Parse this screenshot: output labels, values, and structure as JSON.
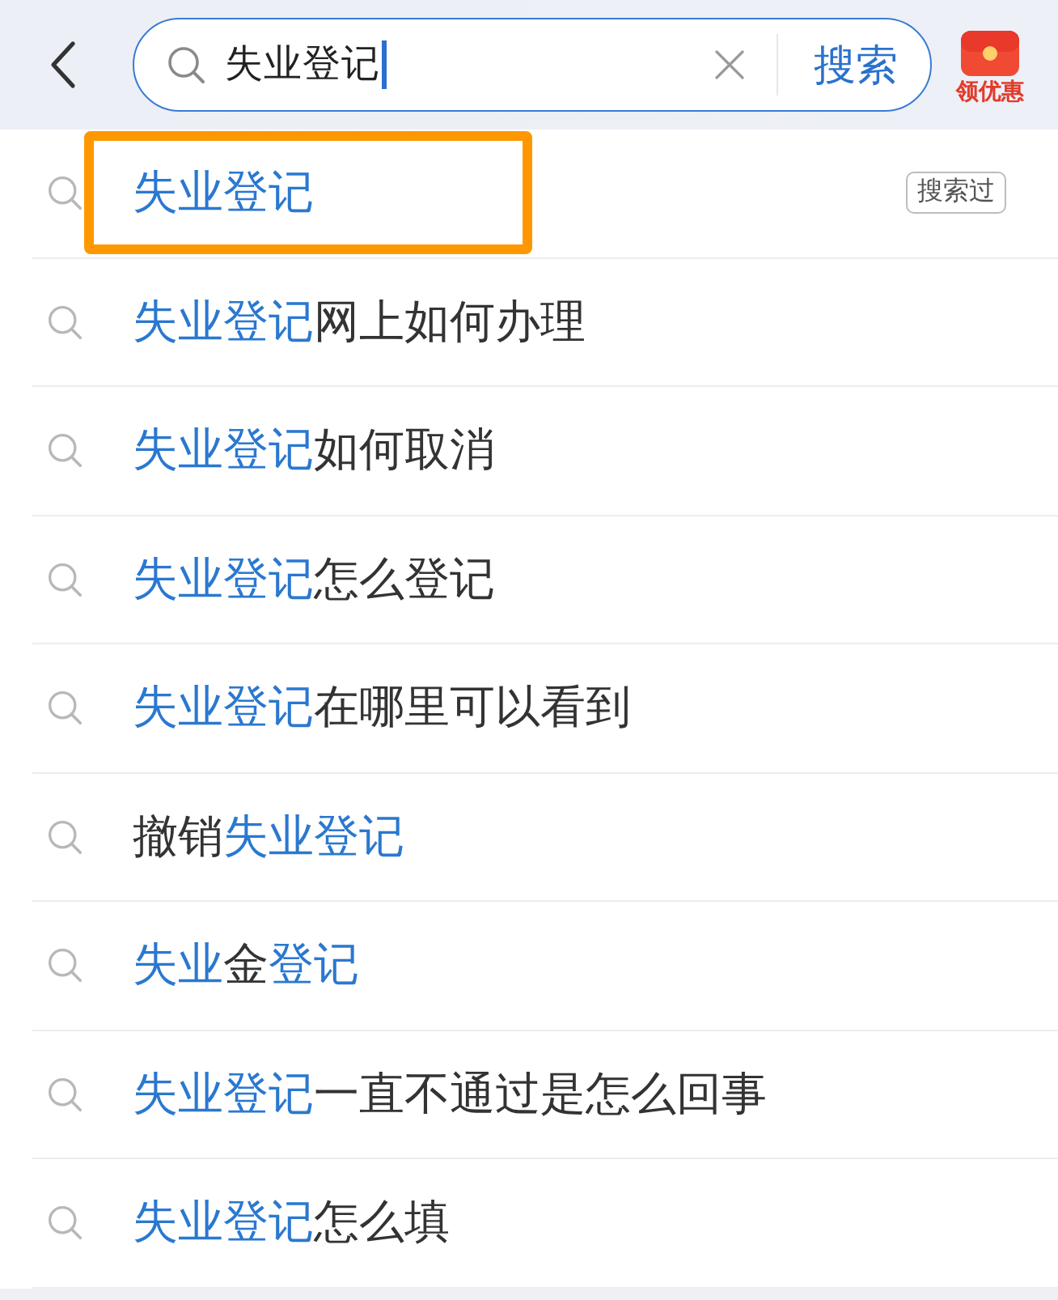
{
  "search_bar": {
    "query": "失业登记",
    "button_label": "搜索"
  },
  "promo_button": {
    "label": "领优惠"
  },
  "suggestions": [
    {
      "segments": [
        {
          "text": "失业登记",
          "matched": true
        }
      ],
      "badge": "搜索过",
      "framed": true
    },
    {
      "segments": [
        {
          "text": "失业登记",
          "matched": true
        },
        {
          "text": "网上如何办理",
          "matched": false
        }
      ],
      "framed": false
    },
    {
      "segments": [
        {
          "text": "失业登记",
          "matched": true
        },
        {
          "text": "如何取消",
          "matched": false
        }
      ],
      "framed": false
    },
    {
      "segments": [
        {
          "text": "失业登记",
          "matched": true
        },
        {
          "text": "怎么登记",
          "matched": false
        }
      ],
      "framed": false
    },
    {
      "segments": [
        {
          "text": "失业登记",
          "matched": true
        },
        {
          "text": "在哪里可以看到",
          "matched": false
        }
      ],
      "framed": false
    },
    {
      "segments": [
        {
          "text": "撤销",
          "matched": false
        },
        {
          "text": "失业登记",
          "matched": true
        }
      ],
      "framed": false
    },
    {
      "segments": [
        {
          "text": "失业",
          "matched": true
        },
        {
          "text": "金",
          "matched": false
        },
        {
          "text": "登记",
          "matched": true
        }
      ],
      "framed": false
    },
    {
      "segments": [
        {
          "text": "失业登记",
          "matched": true
        },
        {
          "text": "一直不通过是怎么回事",
          "matched": false
        }
      ],
      "framed": false
    },
    {
      "segments": [
        {
          "text": "失业登记",
          "matched": true
        },
        {
          "text": "怎么填",
          "matched": false
        }
      ],
      "framed": false
    }
  ]
}
